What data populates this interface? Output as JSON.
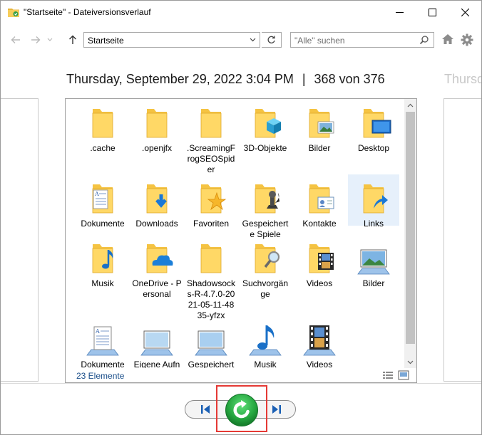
{
  "window": {
    "title": "\"Startseite\" - Dateiversionsverlauf"
  },
  "toolbar": {
    "address_value": "Startseite",
    "search_placeholder": "\"Alle\" suchen"
  },
  "header": {
    "date": "Thursday, September 29, 2022 3:04 PM",
    "separator": "|",
    "position": "368 von 376",
    "next_date_partial": "Thursd"
  },
  "files": [
    {
      "label": ".cache",
      "icon": "folder"
    },
    {
      "label": ".openjfx",
      "icon": "folder"
    },
    {
      "label": ".ScreamingFrogSEOSpider",
      "icon": "folder"
    },
    {
      "label": "3D-Objekte",
      "icon": "folder-3d"
    },
    {
      "label": "Bilder",
      "icon": "folder-pictures"
    },
    {
      "label": "Desktop",
      "icon": "folder-desktop"
    },
    {
      "label": "Dokumente",
      "icon": "folder-documents"
    },
    {
      "label": "Downloads",
      "icon": "folder-downloads"
    },
    {
      "label": "Favoriten",
      "icon": "folder-favorites"
    },
    {
      "label": "Gespeicherte Spiele",
      "icon": "folder-games"
    },
    {
      "label": "Kontakte",
      "icon": "folder-contacts"
    },
    {
      "label": "Links",
      "icon": "folder-links"
    },
    {
      "label": "Musik",
      "icon": "folder-music"
    },
    {
      "label": "OneDrive - Personal",
      "icon": "folder-onedrive"
    },
    {
      "label": "Shadowsocks-R-4.7.0-2021-05-11-4835-yfzx",
      "icon": "folder"
    },
    {
      "label": "Suchvorgänge",
      "icon": "folder-search"
    },
    {
      "label": "Videos",
      "icon": "folder-videos"
    },
    {
      "label": "Bilder",
      "icon": "library-pictures"
    },
    {
      "label": "Dokumente",
      "icon": "library-documents"
    },
    {
      "label": "Eigene Aufnahmen",
      "icon": "library-recordings"
    },
    {
      "label": "Gespeicherte Bilder",
      "icon": "library-saved-pictures"
    },
    {
      "label": "Musik",
      "icon": "library-music"
    },
    {
      "label": "Videos",
      "icon": "library-videos"
    }
  ],
  "status": {
    "count": "23 Elemente"
  },
  "colors": {
    "folder": "#f5c342",
    "folder_light": "#ffd866",
    "accent_blue": "#1a78d6",
    "restore_green": "#2fb54a",
    "highlight_red": "#e53935",
    "selection": "#e6f0fb"
  }
}
